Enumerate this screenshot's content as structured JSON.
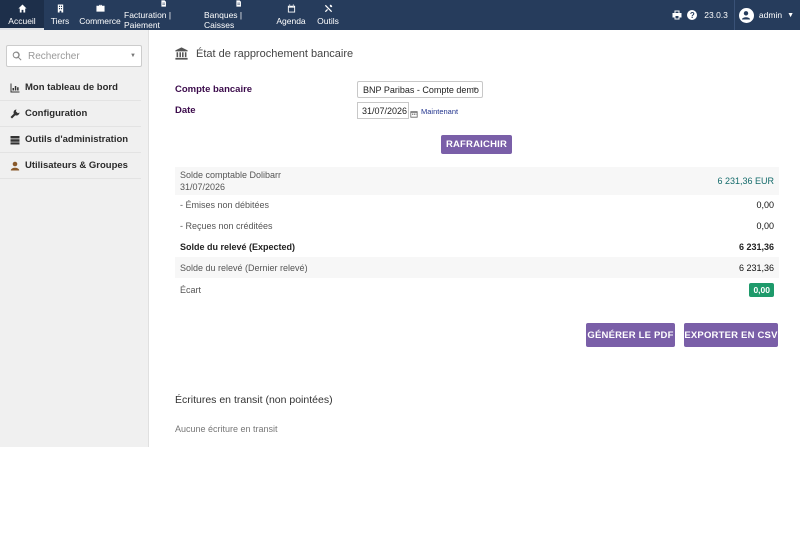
{
  "topbar": {
    "nav": [
      {
        "label": "Accueil",
        "icon": "home-icon"
      },
      {
        "label": "Tiers",
        "icon": "building-icon"
      },
      {
        "label": "Commerce",
        "icon": "briefcase-icon"
      },
      {
        "label": "Facturation | Paiement",
        "icon": "document-icon"
      },
      {
        "label": "Banques | Caisses",
        "icon": "bank-icon"
      },
      {
        "label": "Agenda",
        "icon": "calendar-icon"
      },
      {
        "label": "Outils",
        "icon": "tools-icon"
      }
    ],
    "version": "23.0.3",
    "user": "admin"
  },
  "sidebar": {
    "search_placeholder": "Rechercher",
    "items": [
      {
        "label": "Mon tableau de bord",
        "icon": "chart-icon"
      },
      {
        "label": "Configuration",
        "icon": "wrench-icon"
      },
      {
        "label": "Outils d'administration",
        "icon": "server-icon"
      },
      {
        "label": "Utilisateurs & Groupes",
        "icon": "user-icon"
      }
    ]
  },
  "page": {
    "title": "État de rapprochement bancaire",
    "form": {
      "account_label": "Compte bancaire",
      "account_value": "BNP Paribas - Compte demo",
      "date_label": "Date",
      "date_value": "31/07/2026",
      "now_link": "Maintenant",
      "refresh_button": "RAFRAICHIR"
    },
    "balances": {
      "accounting_label": "Solde comptable Dolibarr",
      "accounting_date": "31/07/2026",
      "accounting_value": "6 231,36 EUR",
      "issued_label": "- Émises non débitées",
      "issued_value": "0,00",
      "received_label": "- Reçues non créditées",
      "received_value": "0,00",
      "expected_label": "Solde du relevé (Expected)",
      "expected_value": "6 231,36",
      "last_label": "Solde du relevé (Dernier relevé)",
      "last_value": "6 231,36",
      "gap_label": "Écart",
      "gap_value": "0,00"
    },
    "actions": {
      "pdf_button": "GÉNÉRER LE PDF",
      "csv_button": "EXPORTER EN CSV"
    },
    "transit": {
      "title": "Écritures en transit (non pointées)",
      "empty": "Aucune écriture en transit"
    }
  },
  "colors": {
    "topbar": "#263c5c",
    "button": "#7a5fa8",
    "success_badge": "#1e9a6b",
    "positive_amount": "#146b6b"
  }
}
